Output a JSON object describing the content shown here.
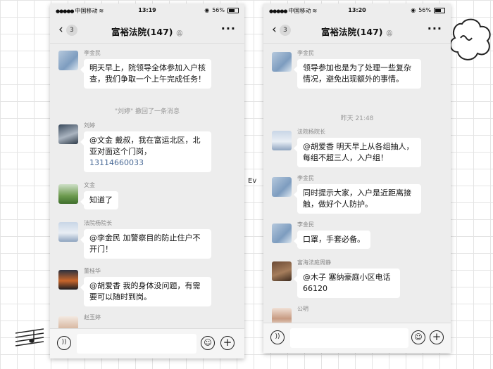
{
  "decor": {
    "middle_text": "Ev"
  },
  "left": {
    "status": {
      "carrier": "中国移动",
      "time": "13:19",
      "battery": "56%"
    },
    "nav": {
      "back_count": "3",
      "title": "富裕法院(147)"
    },
    "messages": [
      {
        "sender": "李金民",
        "text": "明天早上，院领导全体参加入户核查，我们争取一个上午完成任务！"
      },
      {
        "system": "\"刘婷\" 撤回了一条消息"
      },
      {
        "sender": "刘婷",
        "text": "@文金 戴叔，我在富运北区，北亚对面这个门岗，",
        "link": "13114660033"
      },
      {
        "sender": "文金",
        "text": "知道了"
      },
      {
        "sender": "法院杨院长",
        "text": "@李金民 加警察目的防止住户不开门！"
      },
      {
        "sender": "董桂华",
        "text": "@胡爱香 我的身体没问题，有需要可以随时到岗。"
      },
      {
        "sender": "赵玉婷"
      }
    ]
  },
  "right": {
    "status": {
      "carrier": "中国移动",
      "time": "13:20",
      "battery": "56%"
    },
    "nav": {
      "back_count": "3",
      "title": "富裕法院(147)"
    },
    "messages": [
      {
        "sender": "李金民",
        "text": "领导参加也是为了处理一些复杂情况，避免出现额外的事情。"
      },
      {
        "system": "昨天 21:48"
      },
      {
        "sender": "法院杨院长",
        "text": "@胡爱香 明天早上从各组抽人，每组不超三人，入户组！"
      },
      {
        "sender": "李金民",
        "text": "同时提示大家，入户是近距离接触，做好个人防护。"
      },
      {
        "sender": "李金民",
        "text": "口罩，手套必备。"
      },
      {
        "sender": "富海法庭周静",
        "text": "@木子 塞纳豪庭小区电话66120"
      },
      {
        "sender": "公明"
      }
    ]
  }
}
